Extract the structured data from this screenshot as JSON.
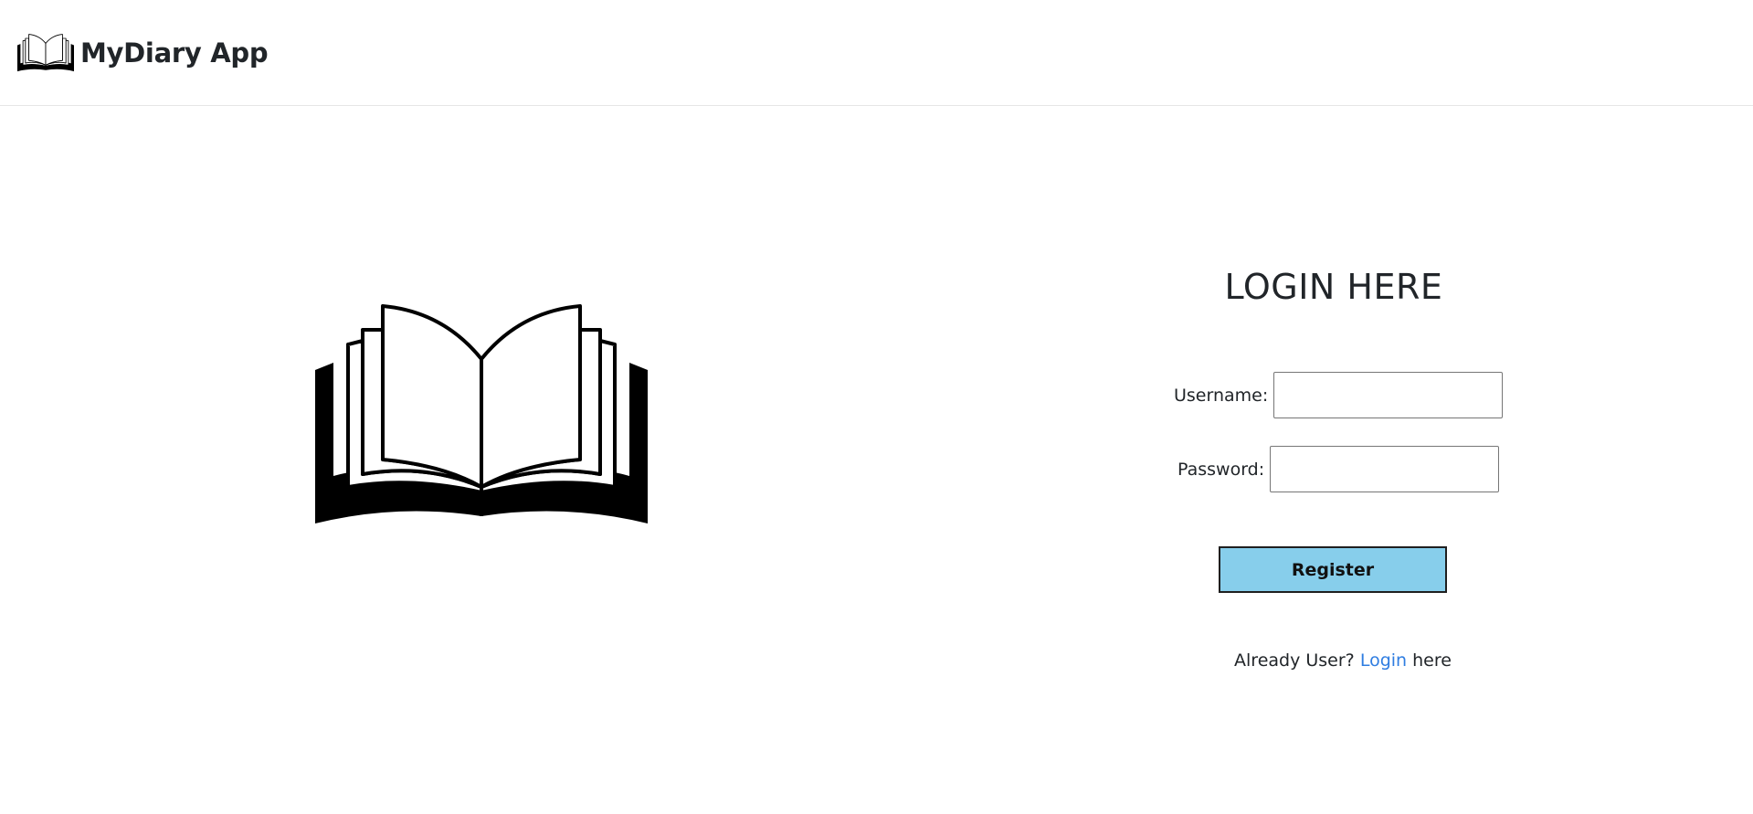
{
  "navbar": {
    "brand_text": "MyDiary App",
    "brand_icon": "open-book-icon"
  },
  "hero": {
    "icon": "open-book-icon"
  },
  "login": {
    "title": "LOGIN HERE",
    "username_label": "Username:",
    "username_value": "",
    "password_label": "Password:",
    "password_value": "",
    "register_label": "Register",
    "register_color": "#87ceeb",
    "hint_prefix": "Already User?",
    "hint_link": "Login",
    "hint_suffix": "here",
    "link_color": "#2f7de1"
  }
}
